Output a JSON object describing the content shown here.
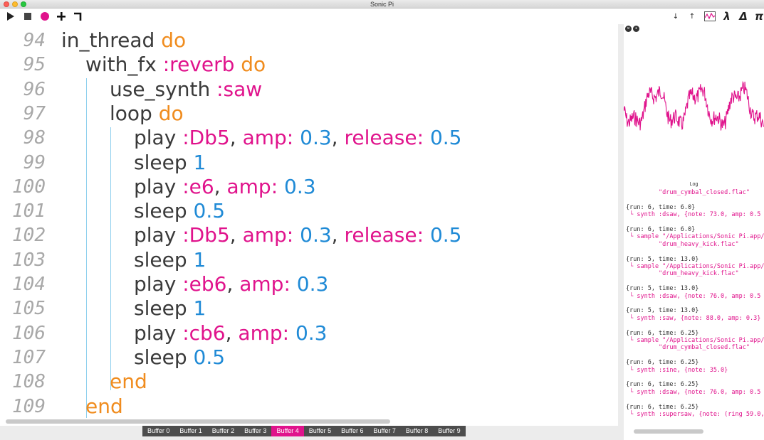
{
  "window": {
    "title": "Sonic Pi"
  },
  "toolbar": {
    "left": [
      {
        "name": "run-icon"
      },
      {
        "name": "stop-icon"
      },
      {
        "name": "record-icon"
      },
      {
        "name": "add-icon"
      },
      {
        "name": "align-icon"
      }
    ],
    "right": [
      {
        "name": "decrease-text-icon",
        "glyph": "↓"
      },
      {
        "name": "increase-text-icon",
        "glyph": "↑"
      },
      {
        "name": "scope-icon",
        "glyph": ""
      },
      {
        "name": "lambda-icon",
        "glyph": "λ"
      },
      {
        "name": "delta-icon",
        "glyph": "Δ"
      },
      {
        "name": "pi-icon",
        "glyph": "π"
      }
    ]
  },
  "colors": {
    "keyword": "#f08c1e",
    "symbol": "#e0138c",
    "number": "#1f8ad6",
    "text": "#3a3a3a",
    "active_tab": "#e0138c",
    "scope_wave": "#e0138c"
  },
  "code": {
    "lines": [
      {
        "num": "94",
        "indent": 0,
        "tokens": [
          {
            "t": "in_thread ",
            "c": "text"
          },
          {
            "t": "do",
            "c": "kw"
          }
        ]
      },
      {
        "num": "95",
        "indent": 1,
        "tokens": [
          {
            "t": "with_fx ",
            "c": "text"
          },
          {
            "t": ":reverb",
            "c": "sym"
          },
          {
            "t": " ",
            "c": "text"
          },
          {
            "t": "do",
            "c": "kw"
          }
        ]
      },
      {
        "num": "96",
        "indent": 2,
        "tokens": [
          {
            "t": "use_synth ",
            "c": "text"
          },
          {
            "t": ":saw",
            "c": "sym"
          }
        ]
      },
      {
        "num": "97",
        "indent": 2,
        "tokens": [
          {
            "t": "loop ",
            "c": "text"
          },
          {
            "t": "do",
            "c": "kw"
          }
        ]
      },
      {
        "num": "98",
        "indent": 3,
        "tokens": [
          {
            "t": "play ",
            "c": "text"
          },
          {
            "t": ":Db5",
            "c": "sym"
          },
          {
            "t": ", ",
            "c": "text"
          },
          {
            "t": "amp:",
            "c": "sym"
          },
          {
            "t": " ",
            "c": "text"
          },
          {
            "t": "0.3",
            "c": "num"
          },
          {
            "t": ", ",
            "c": "text"
          },
          {
            "t": "release:",
            "c": "sym"
          },
          {
            "t": " ",
            "c": "text"
          },
          {
            "t": "0.5",
            "c": "num"
          }
        ]
      },
      {
        "num": "99",
        "indent": 3,
        "tokens": [
          {
            "t": "sleep ",
            "c": "text"
          },
          {
            "t": "1",
            "c": "num"
          }
        ]
      },
      {
        "num": "100",
        "indent": 3,
        "tokens": [
          {
            "t": "play ",
            "c": "text"
          },
          {
            "t": ":e6",
            "c": "sym"
          },
          {
            "t": ", ",
            "c": "text"
          },
          {
            "t": "amp:",
            "c": "sym"
          },
          {
            "t": " ",
            "c": "text"
          },
          {
            "t": "0.3",
            "c": "num"
          }
        ]
      },
      {
        "num": "101",
        "indent": 3,
        "tokens": [
          {
            "t": "sleep ",
            "c": "text"
          },
          {
            "t": "0.5",
            "c": "num"
          }
        ]
      },
      {
        "num": "102",
        "indent": 3,
        "tokens": [
          {
            "t": "play ",
            "c": "text"
          },
          {
            "t": ":Db5",
            "c": "sym"
          },
          {
            "t": ", ",
            "c": "text"
          },
          {
            "t": "amp:",
            "c": "sym"
          },
          {
            "t": " ",
            "c": "text"
          },
          {
            "t": "0.3",
            "c": "num"
          },
          {
            "t": ", ",
            "c": "text"
          },
          {
            "t": "release:",
            "c": "sym"
          },
          {
            "t": " ",
            "c": "text"
          },
          {
            "t": "0.5",
            "c": "num"
          }
        ]
      },
      {
        "num": "103",
        "indent": 3,
        "tokens": [
          {
            "t": "sleep ",
            "c": "text"
          },
          {
            "t": "1",
            "c": "num"
          }
        ]
      },
      {
        "num": "104",
        "indent": 3,
        "tokens": [
          {
            "t": "play ",
            "c": "text"
          },
          {
            "t": ":eb6",
            "c": "sym"
          },
          {
            "t": ", ",
            "c": "text"
          },
          {
            "t": "amp:",
            "c": "sym"
          },
          {
            "t": " ",
            "c": "text"
          },
          {
            "t": "0.3",
            "c": "num"
          }
        ]
      },
      {
        "num": "105",
        "indent": 3,
        "tokens": [
          {
            "t": "sleep ",
            "c": "text"
          },
          {
            "t": "1",
            "c": "num"
          }
        ]
      },
      {
        "num": "106",
        "indent": 3,
        "tokens": [
          {
            "t": "play ",
            "c": "text"
          },
          {
            "t": ":cb6",
            "c": "sym"
          },
          {
            "t": ", ",
            "c": "text"
          },
          {
            "t": "amp:",
            "c": "sym"
          },
          {
            "t": " ",
            "c": "text"
          },
          {
            "t": "0.3",
            "c": "num"
          }
        ]
      },
      {
        "num": "107",
        "indent": 3,
        "tokens": [
          {
            "t": "sleep ",
            "c": "text"
          },
          {
            "t": "0.5",
            "c": "num"
          }
        ]
      },
      {
        "num": "108",
        "indent": 2,
        "tokens": [
          {
            "t": "end",
            "c": "kw"
          }
        ]
      },
      {
        "num": "109",
        "indent": 1,
        "tokens": [
          {
            "t": "end",
            "c": "kw"
          }
        ]
      }
    ]
  },
  "tabs": [
    {
      "label": "Buffer 0",
      "active": false
    },
    {
      "label": "Buffer 1",
      "active": false
    },
    {
      "label": "Buffer 2",
      "active": false
    },
    {
      "label": "Buffer 3",
      "active": false
    },
    {
      "label": "Buffer 4",
      "active": true
    },
    {
      "label": "Buffer 5",
      "active": false
    },
    {
      "label": "Buffer 6",
      "active": false
    },
    {
      "label": "Buffer 7",
      "active": false
    },
    {
      "label": "Buffer 8",
      "active": false
    },
    {
      "label": "Buffer 9",
      "active": false
    }
  ],
  "log": {
    "title": "Log",
    "entries": [
      {
        "type": "act",
        "text": "         \"drum_cymbal_closed.flac\""
      },
      {
        "type": "gap"
      },
      {
        "type": "run",
        "text": "{run: 6, time: 6.0}"
      },
      {
        "type": "act",
        "text": " └ synth :dsaw, {note: 73.0, amp: 0.5"
      },
      {
        "type": "gap"
      },
      {
        "type": "run",
        "text": "{run: 6, time: 6.0}"
      },
      {
        "type": "act",
        "text": " └ sample \"/Applications/Sonic Pi.app/"
      },
      {
        "type": "act",
        "text": "         \"drum_heavy_kick.flac\""
      },
      {
        "type": "gap"
      },
      {
        "type": "run",
        "text": "{run: 5, time: 13.0}"
      },
      {
        "type": "act",
        "text": " └ sample \"/Applications/Sonic Pi.app/"
      },
      {
        "type": "act",
        "text": "         \"drum_heavy_kick.flac\""
      },
      {
        "type": "gap"
      },
      {
        "type": "run",
        "text": "{run: 5, time: 13.0}"
      },
      {
        "type": "act",
        "text": " └ synth :dsaw, {note: 76.0, amp: 0.5"
      },
      {
        "type": "gap"
      },
      {
        "type": "run",
        "text": "{run: 5, time: 13.0}"
      },
      {
        "type": "act",
        "text": " └ synth :saw, {note: 88.0, amp: 0.3}"
      },
      {
        "type": "gap"
      },
      {
        "type": "run",
        "text": "{run: 6, time: 6.25}"
      },
      {
        "type": "act",
        "text": " └ sample \"/Applications/Sonic Pi.app/"
      },
      {
        "type": "act",
        "text": "         \"drum_cymbal_closed.flac\""
      },
      {
        "type": "gap"
      },
      {
        "type": "run",
        "text": "{run: 6, time: 6.25}"
      },
      {
        "type": "act",
        "text": " └ synth :sine, {note: 35.0}"
      },
      {
        "type": "gap"
      },
      {
        "type": "run",
        "text": "{run: 6, time: 6.25}"
      },
      {
        "type": "act",
        "text": " └ synth :dsaw, {note: 76.0, amp: 0.5"
      },
      {
        "type": "gap"
      },
      {
        "type": "run",
        "text": "{run: 6, time: 6.25}"
      },
      {
        "type": "act",
        "text": " └ synth :supersaw, {note: (ring 59.0,"
      }
    ]
  }
}
